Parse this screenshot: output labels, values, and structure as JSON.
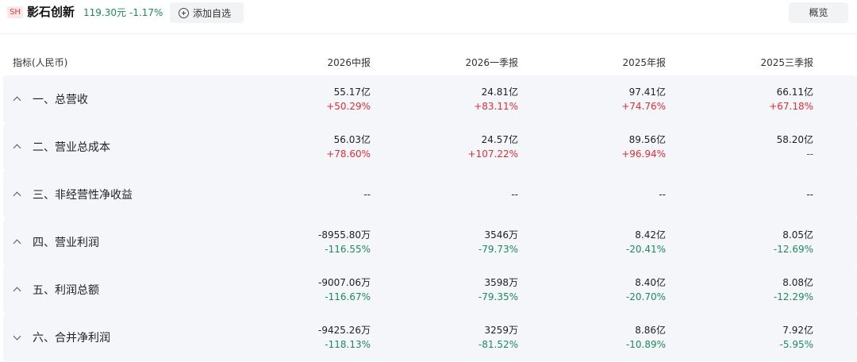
{
  "header": {
    "exchange": "SH",
    "name": "影石创新",
    "price": "119.30元",
    "change": "-1.17%",
    "add_label": "添加自选",
    "overview_label": "概览"
  },
  "table": {
    "first_header": "指标(人民币)",
    "columns": [
      "2026中报",
      "2026一季报",
      "2025年报",
      "2025三季报"
    ],
    "rows": [
      {
        "label": "一、总营收",
        "expanded": true,
        "cells": [
          {
            "value": "55.17亿",
            "change": "+50.29%",
            "dir": "up"
          },
          {
            "value": "24.81亿",
            "change": "+83.11%",
            "dir": "up"
          },
          {
            "value": "97.41亿",
            "change": "+74.76%",
            "dir": "up"
          },
          {
            "value": "66.11亿",
            "change": "+67.18%",
            "dir": "up"
          }
        ]
      },
      {
        "label": "二、营业总成本",
        "expanded": true,
        "cells": [
          {
            "value": "56.03亿",
            "change": "+78.60%",
            "dir": "up"
          },
          {
            "value": "24.57亿",
            "change": "+107.22%",
            "dir": "up"
          },
          {
            "value": "89.56亿",
            "change": "+96.94%",
            "dir": "up"
          },
          {
            "value": "58.20亿",
            "change": "--",
            "dir": "flat"
          }
        ]
      },
      {
        "label": "三、非经营性净收益",
        "expanded": true,
        "cells": [
          {
            "value": "--",
            "change": "",
            "dir": "flat"
          },
          {
            "value": "--",
            "change": "",
            "dir": "flat"
          },
          {
            "value": "--",
            "change": "",
            "dir": "flat"
          },
          {
            "value": "--",
            "change": "",
            "dir": "flat"
          }
        ]
      },
      {
        "label": "四、营业利润",
        "expanded": true,
        "cells": [
          {
            "value": "-8955.80万",
            "change": "-116.55%",
            "dir": "down"
          },
          {
            "value": "3546万",
            "change": "-79.73%",
            "dir": "down"
          },
          {
            "value": "8.42亿",
            "change": "-20.41%",
            "dir": "down"
          },
          {
            "value": "8.05亿",
            "change": "-12.69%",
            "dir": "down"
          }
        ]
      },
      {
        "label": "五、利润总额",
        "expanded": true,
        "cells": [
          {
            "value": "-9007.06万",
            "change": "-116.67%",
            "dir": "down"
          },
          {
            "value": "3598万",
            "change": "-79.35%",
            "dir": "down"
          },
          {
            "value": "8.40亿",
            "change": "-20.70%",
            "dir": "down"
          },
          {
            "value": "8.08亿",
            "change": "-12.29%",
            "dir": "down"
          }
        ]
      },
      {
        "label": "六、合并净利润",
        "expanded": false,
        "cells": [
          {
            "value": "-9425.26万",
            "change": "-118.13%",
            "dir": "down"
          },
          {
            "value": "3259万",
            "change": "-81.52%",
            "dir": "down"
          },
          {
            "value": "8.86亿",
            "change": "-10.89%",
            "dir": "down"
          },
          {
            "value": "7.92亿",
            "change": "-5.95%",
            "dir": "down"
          }
        ]
      }
    ]
  }
}
